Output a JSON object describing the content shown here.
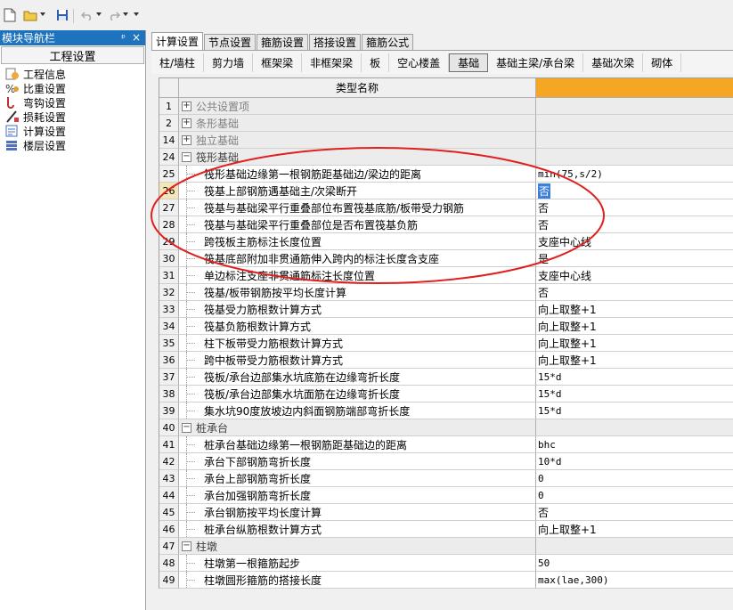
{
  "toolbar": {
    "icons": [
      "new-file-icon",
      "open-folder-icon",
      "save-icon",
      "undo-icon",
      "redo-icon",
      "overflow-icon"
    ]
  },
  "sidebar": {
    "title": "模块导航栏",
    "pin": "ᵖ",
    "close": "×",
    "group": "工程设置",
    "items": [
      {
        "label": "工程信息",
        "icon": "project-info-icon"
      },
      {
        "label": "比重设置",
        "icon": "weight-settings-icon"
      },
      {
        "label": "弯钩设置",
        "icon": "hook-settings-icon"
      },
      {
        "label": "损耗设置",
        "icon": "loss-settings-icon"
      },
      {
        "label": "计算设置",
        "icon": "calc-settings-icon"
      },
      {
        "label": "楼层设置",
        "icon": "floor-settings-icon"
      }
    ]
  },
  "tabs": [
    "计算设置",
    "节点设置",
    "箍筋设置",
    "搭接设置",
    "箍筋公式"
  ],
  "active_tab": 0,
  "subtabs": [
    "柱/墙柱",
    "剪力墙",
    "框架梁",
    "非框架梁",
    "板",
    "空心楼盖",
    "基础",
    "基础主梁/承台梁",
    "基础次梁",
    "砌体"
  ],
  "active_subtab": 6,
  "grid": {
    "header": "类型名称",
    "rows": [
      {
        "num": "1",
        "name": "公共设置项",
        "value": "",
        "type": "group",
        "open": false
      },
      {
        "num": "2",
        "name": "条形基础",
        "value": "",
        "type": "group",
        "open": false
      },
      {
        "num": "14",
        "name": "独立基础",
        "value": "",
        "type": "group",
        "open": false
      },
      {
        "num": "24",
        "name": "筏形基础",
        "value": "",
        "type": "group",
        "open": true
      },
      {
        "num": "25",
        "name": "筏形基础边缘第一根钢筋距基础边/梁边的距离",
        "value": "min(75,s/2)",
        "mono": true
      },
      {
        "num": "26",
        "name": "筏基上部钢筋遇基础主/次梁断开",
        "value": "否",
        "selected": true
      },
      {
        "num": "27",
        "name": "筏基与基础梁平行重叠部位布置筏基底筋/板带受力钢筋",
        "value": "否"
      },
      {
        "num": "28",
        "name": "筏基与基础梁平行重叠部位是否布置筏基负筋",
        "value": "否"
      },
      {
        "num": "29",
        "name": "跨筏板主筋标注长度位置",
        "value": "支座中心线"
      },
      {
        "num": "30",
        "name": "筏基底部附加非贯通筋伸入跨内的标注长度含支座",
        "value": "是"
      },
      {
        "num": "31",
        "name": "单边标注支座非贯通筋标注长度位置",
        "value": "支座中心线"
      },
      {
        "num": "32",
        "name": "筏基/板带钢筋按平均长度计算",
        "value": "否"
      },
      {
        "num": "33",
        "name": "筏基受力筋根数计算方式",
        "value": "向上取整+1"
      },
      {
        "num": "34",
        "name": "筏基负筋根数计算方式",
        "value": "向上取整+1"
      },
      {
        "num": "35",
        "name": "柱下板带受力筋根数计算方式",
        "value": "向上取整+1"
      },
      {
        "num": "36",
        "name": "跨中板带受力筋根数计算方式",
        "value": "向上取整+1"
      },
      {
        "num": "37",
        "name": "筏板/承台边部集水坑底筋在边缘弯折长度",
        "value": "15*d",
        "mono": true
      },
      {
        "num": "38",
        "name": "筏板/承台边部集水坑面筋在边缘弯折长度",
        "value": "15*d",
        "mono": true
      },
      {
        "num": "39",
        "name": "集水坑90度放坡边内斜面钢筋端部弯折长度",
        "value": "15*d",
        "mono": true
      },
      {
        "num": "40",
        "name": "桩承台",
        "value": "",
        "type": "group",
        "open": true
      },
      {
        "num": "41",
        "name": "桩承台基础边缘第一根钢筋距基础边的距离",
        "value": "bhc",
        "mono": true
      },
      {
        "num": "42",
        "name": "承台下部钢筋弯折长度",
        "value": "10*d",
        "mono": true
      },
      {
        "num": "43",
        "name": "承台上部钢筋弯折长度",
        "value": "0",
        "mono": true
      },
      {
        "num": "44",
        "name": "承台加强钢筋弯折长度",
        "value": "0",
        "mono": true
      },
      {
        "num": "45",
        "name": "承台钢筋按平均长度计算",
        "value": "否"
      },
      {
        "num": "46",
        "name": "桩承台纵筋根数计算方式",
        "value": "向上取整+1"
      },
      {
        "num": "47",
        "name": "柱墩",
        "value": "",
        "type": "group",
        "open": true
      },
      {
        "num": "48",
        "name": "柱墩第一根箍筋起步",
        "value": "50",
        "mono": true
      },
      {
        "num": "49",
        "name": "柱墩圆形箍筋的搭接长度",
        "value": "max(lae,300)",
        "mono": true
      }
    ]
  },
  "colors": {
    "accent_header": "#f5a623",
    "sidebar_title_bg": "#1e73be",
    "annotation": "#e02020",
    "selection": "#3a7fd8"
  }
}
